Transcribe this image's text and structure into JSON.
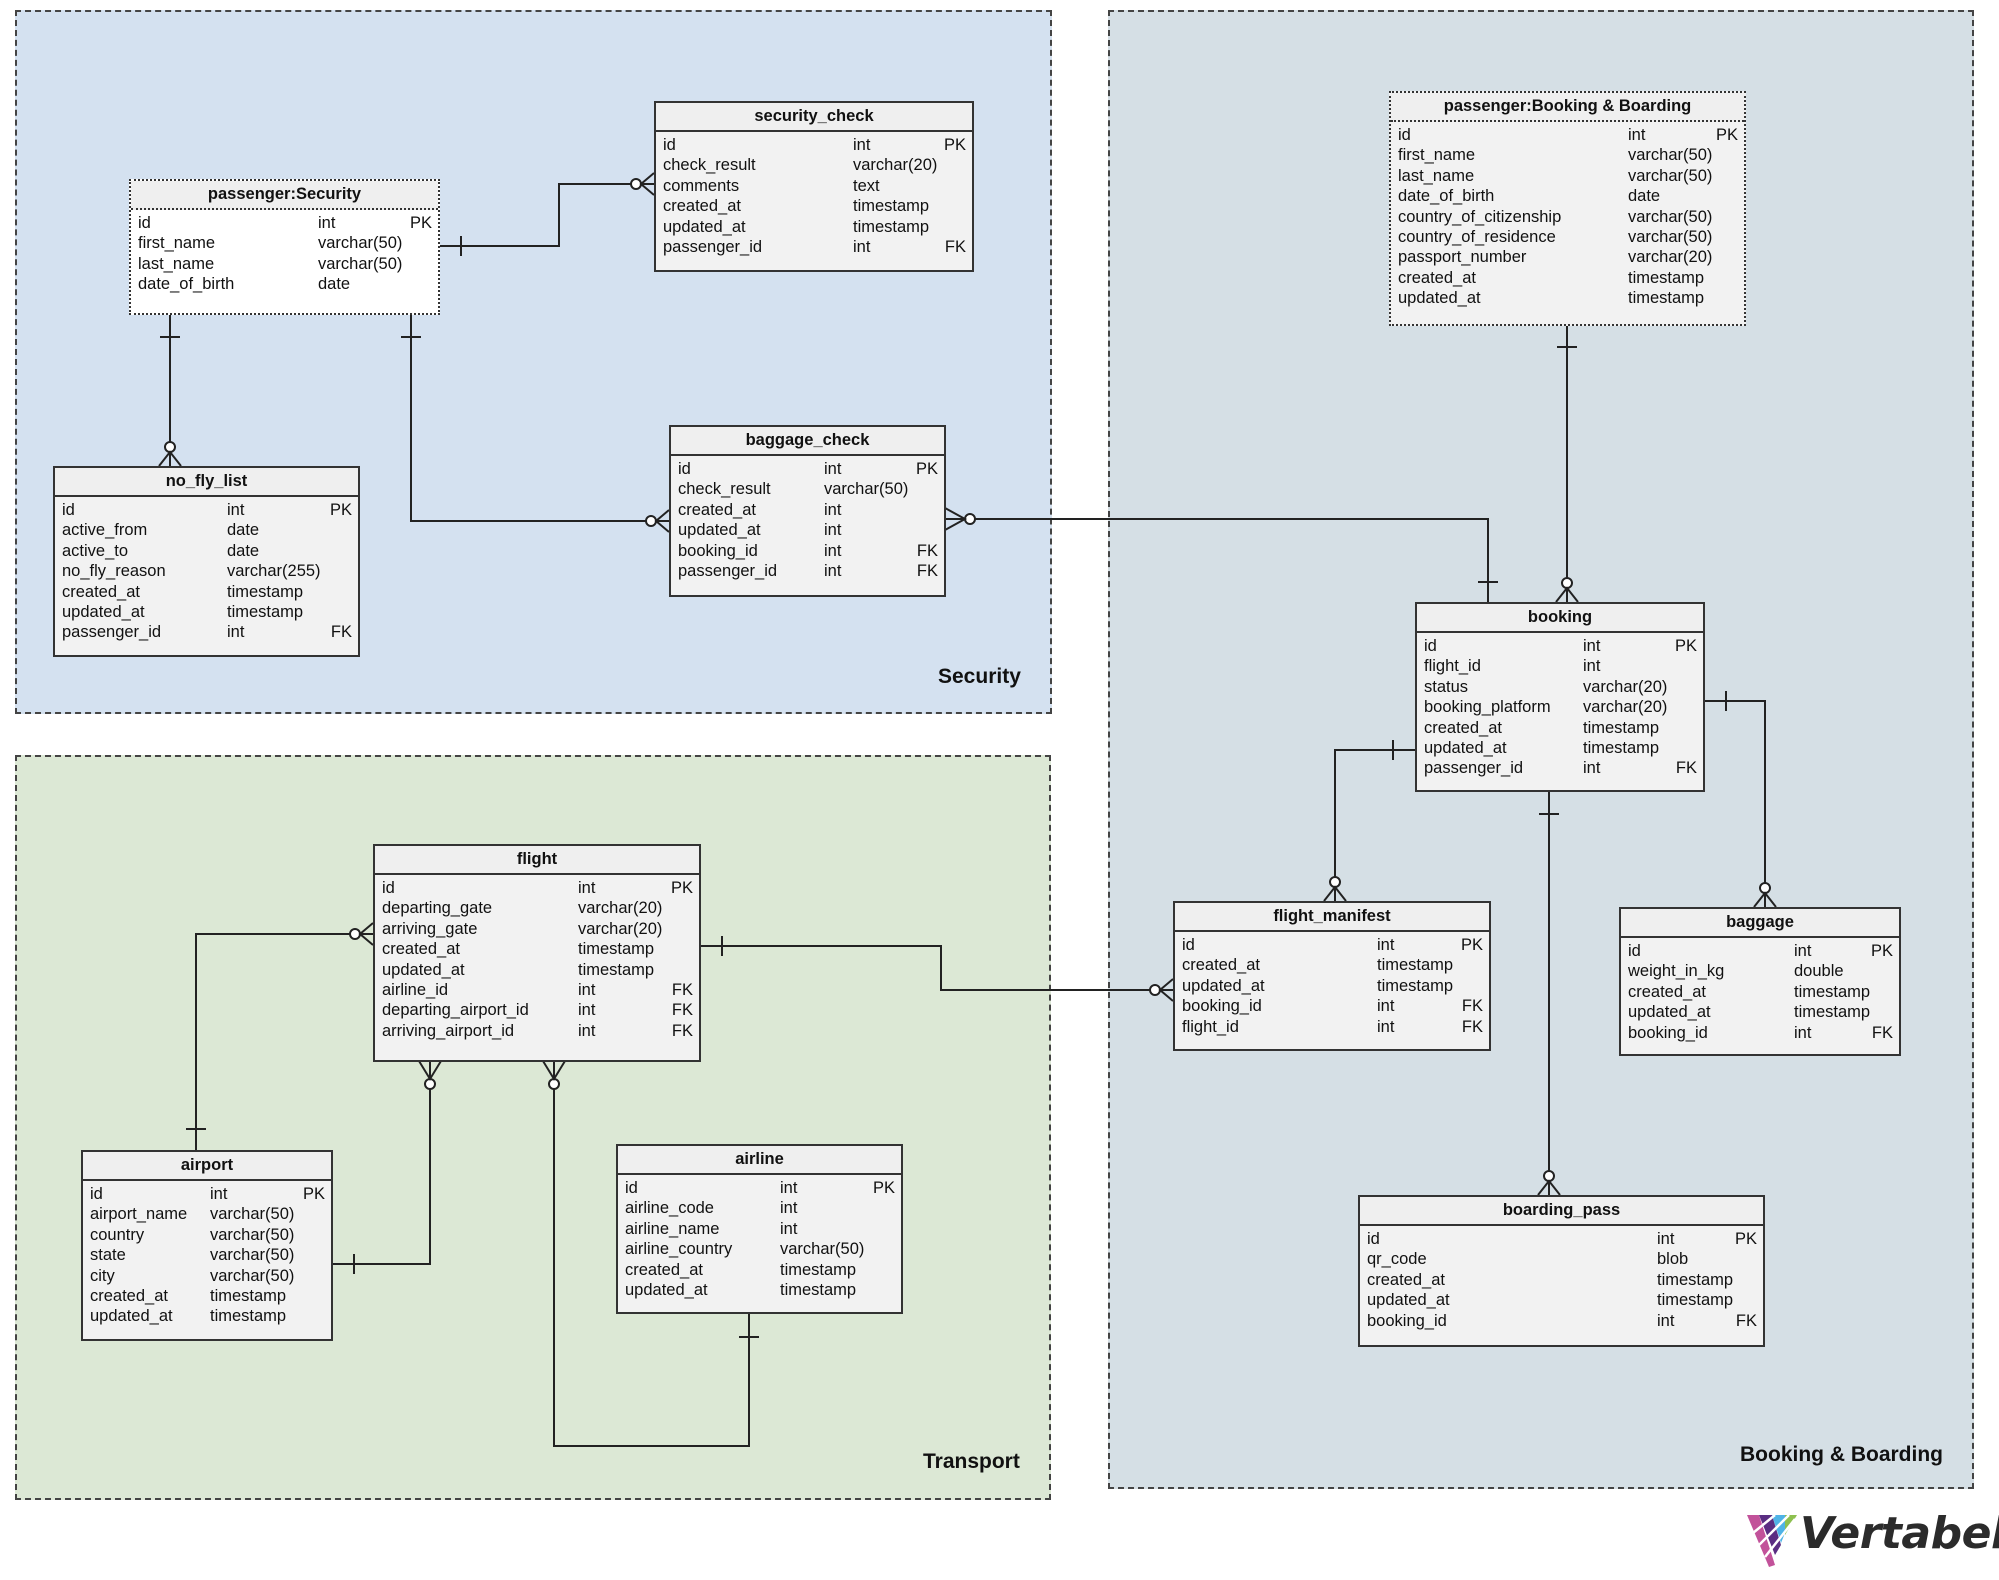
{
  "colors": {
    "security_bg": "#d4e1f0",
    "transport_bg": "#dce8d5",
    "booking_bg": "#d5dfe5"
  },
  "regions": {
    "security": {
      "label": "Security"
    },
    "transport": {
      "label": "Transport"
    },
    "booking": {
      "label": "Booking & Boarding"
    }
  },
  "tables": {
    "passenger_security": {
      "title": "passenger:Security",
      "columns": [
        {
          "name": "id",
          "type": "int",
          "key": "PK"
        },
        {
          "name": "first_name",
          "type": "varchar(50)",
          "key": ""
        },
        {
          "name": "last_name",
          "type": "varchar(50)",
          "key": ""
        },
        {
          "name": "date_of_birth",
          "type": "date",
          "key": ""
        }
      ]
    },
    "security_check": {
      "title": "security_check",
      "columns": [
        {
          "name": "id",
          "type": "int",
          "key": "PK"
        },
        {
          "name": "check_result",
          "type": "varchar(20)",
          "key": ""
        },
        {
          "name": "comments",
          "type": "text",
          "key": ""
        },
        {
          "name": "created_at",
          "type": "timestamp",
          "key": ""
        },
        {
          "name": "updated_at",
          "type": "timestamp",
          "key": ""
        },
        {
          "name": "passenger_id",
          "type": "int",
          "key": "FK"
        }
      ]
    },
    "no_fly_list": {
      "title": "no_fly_list",
      "columns": [
        {
          "name": "id",
          "type": "int",
          "key": "PK"
        },
        {
          "name": "active_from",
          "type": "date",
          "key": ""
        },
        {
          "name": "active_to",
          "type": "date",
          "key": ""
        },
        {
          "name": "no_fly_reason",
          "type": "varchar(255)",
          "key": ""
        },
        {
          "name": "created_at",
          "type": "timestamp",
          "key": ""
        },
        {
          "name": "updated_at",
          "type": "timestamp",
          "key": ""
        },
        {
          "name": "passenger_id",
          "type": "int",
          "key": "FK"
        }
      ]
    },
    "baggage_check": {
      "title": "baggage_check",
      "columns": [
        {
          "name": "id",
          "type": "int",
          "key": "PK"
        },
        {
          "name": "check_result",
          "type": "varchar(50)",
          "key": ""
        },
        {
          "name": "created_at",
          "type": "int",
          "key": ""
        },
        {
          "name": "updated_at",
          "type": "int",
          "key": ""
        },
        {
          "name": "booking_id",
          "type": "int",
          "key": "FK"
        },
        {
          "name": "passenger_id",
          "type": "int",
          "key": "FK"
        }
      ]
    },
    "passenger_booking": {
      "title": "passenger:Booking & Boarding",
      "columns": [
        {
          "name": "id",
          "type": "int",
          "key": "PK"
        },
        {
          "name": "first_name",
          "type": "varchar(50)",
          "key": ""
        },
        {
          "name": "last_name",
          "type": "varchar(50)",
          "key": ""
        },
        {
          "name": "date_of_birth",
          "type": "date",
          "key": ""
        },
        {
          "name": "country_of_citizenship",
          "type": "varchar(50)",
          "key": ""
        },
        {
          "name": "country_of_residence",
          "type": "varchar(50)",
          "key": ""
        },
        {
          "name": "passport_number",
          "type": "varchar(20)",
          "key": ""
        },
        {
          "name": "created_at",
          "type": "timestamp",
          "key": ""
        },
        {
          "name": "updated_at",
          "type": "timestamp",
          "key": ""
        }
      ]
    },
    "booking": {
      "title": "booking",
      "columns": [
        {
          "name": "id",
          "type": "int",
          "key": "PK"
        },
        {
          "name": "flight_id",
          "type": "int",
          "key": ""
        },
        {
          "name": "status",
          "type": "varchar(20)",
          "key": ""
        },
        {
          "name": "booking_platform",
          "type": "varchar(20)",
          "key": ""
        },
        {
          "name": "created_at",
          "type": "timestamp",
          "key": ""
        },
        {
          "name": "updated_at",
          "type": "timestamp",
          "key": ""
        },
        {
          "name": "passenger_id",
          "type": "int",
          "key": "FK"
        }
      ]
    },
    "flight_manifest": {
      "title": "flight_manifest",
      "columns": [
        {
          "name": "id",
          "type": "int",
          "key": "PK"
        },
        {
          "name": "created_at",
          "type": "timestamp",
          "key": ""
        },
        {
          "name": "updated_at",
          "type": "timestamp",
          "key": ""
        },
        {
          "name": "booking_id",
          "type": "int",
          "key": "FK"
        },
        {
          "name": "flight_id",
          "type": "int",
          "key": "FK"
        }
      ]
    },
    "baggage": {
      "title": "baggage",
      "columns": [
        {
          "name": "id",
          "type": "int",
          "key": "PK"
        },
        {
          "name": "weight_in_kg",
          "type": "double",
          "key": ""
        },
        {
          "name": "created_at",
          "type": "timestamp",
          "key": ""
        },
        {
          "name": "updated_at",
          "type": "timestamp",
          "key": ""
        },
        {
          "name": "booking_id",
          "type": "int",
          "key": "FK"
        }
      ]
    },
    "boarding_pass": {
      "title": "boarding_pass",
      "columns": [
        {
          "name": "id",
          "type": "int",
          "key": "PK"
        },
        {
          "name": "qr_code",
          "type": "blob",
          "key": ""
        },
        {
          "name": "created_at",
          "type": "timestamp",
          "key": ""
        },
        {
          "name": "updated_at",
          "type": "timestamp",
          "key": ""
        },
        {
          "name": "booking_id",
          "type": "int",
          "key": "FK"
        }
      ]
    },
    "flight": {
      "title": "flight",
      "columns": [
        {
          "name": "id",
          "type": "int",
          "key": "PK"
        },
        {
          "name": "departing_gate",
          "type": "varchar(20)",
          "key": ""
        },
        {
          "name": "arriving_gate",
          "type": "varchar(20)",
          "key": ""
        },
        {
          "name": "created_at",
          "type": "timestamp",
          "key": ""
        },
        {
          "name": "updated_at",
          "type": "timestamp",
          "key": ""
        },
        {
          "name": "airline_id",
          "type": "int",
          "key": "FK"
        },
        {
          "name": "departing_airport_id",
          "type": "int",
          "key": "FK"
        },
        {
          "name": "arriving_airport_id",
          "type": "int",
          "key": "FK"
        }
      ]
    },
    "airport": {
      "title": "airport",
      "columns": [
        {
          "name": "id",
          "type": "int",
          "key": "PK"
        },
        {
          "name": "airport_name",
          "type": "varchar(50)",
          "key": ""
        },
        {
          "name": "country",
          "type": "varchar(50)",
          "key": ""
        },
        {
          "name": "state",
          "type": "varchar(50)",
          "key": ""
        },
        {
          "name": "city",
          "type": "varchar(50)",
          "key": ""
        },
        {
          "name": "created_at",
          "type": "timestamp",
          "key": ""
        },
        {
          "name": "updated_at",
          "type": "timestamp",
          "key": ""
        }
      ]
    },
    "airline": {
      "title": "airline",
      "columns": [
        {
          "name": "id",
          "type": "int",
          "key": "PK"
        },
        {
          "name": "airline_code",
          "type": "int",
          "key": ""
        },
        {
          "name": "airline_name",
          "type": "int",
          "key": ""
        },
        {
          "name": "airline_country",
          "type": "varchar(50)",
          "key": ""
        },
        {
          "name": "created_at",
          "type": "timestamp",
          "key": ""
        },
        {
          "name": "updated_at",
          "type": "timestamp",
          "key": ""
        }
      ]
    }
  },
  "relationships": [
    {
      "from": "passenger_security",
      "to": "security_check",
      "cardinality": "one-to-many"
    },
    {
      "from": "passenger_security",
      "to": "no_fly_list",
      "cardinality": "one-to-many"
    },
    {
      "from": "passenger_security",
      "to": "baggage_check",
      "cardinality": "one-to-many"
    },
    {
      "from": "booking",
      "to": "baggage_check",
      "cardinality": "one-to-many"
    },
    {
      "from": "passenger_booking",
      "to": "booking",
      "cardinality": "one-to-many"
    },
    {
      "from": "booking",
      "to": "flight_manifest",
      "cardinality": "one-to-many"
    },
    {
      "from": "booking",
      "to": "baggage",
      "cardinality": "one-to-many"
    },
    {
      "from": "booking",
      "to": "boarding_pass",
      "cardinality": "one-to-many"
    },
    {
      "from": "flight",
      "to": "flight_manifest",
      "cardinality": "one-to-many"
    },
    {
      "from": "airport",
      "to": "flight",
      "cardinality": "one-to-many",
      "via": "departing"
    },
    {
      "from": "airport",
      "to": "flight",
      "cardinality": "one-to-many",
      "via": "arriving"
    },
    {
      "from": "airline",
      "to": "flight",
      "cardinality": "one-to-many"
    }
  ],
  "logo": {
    "text": "Vertabelo"
  }
}
